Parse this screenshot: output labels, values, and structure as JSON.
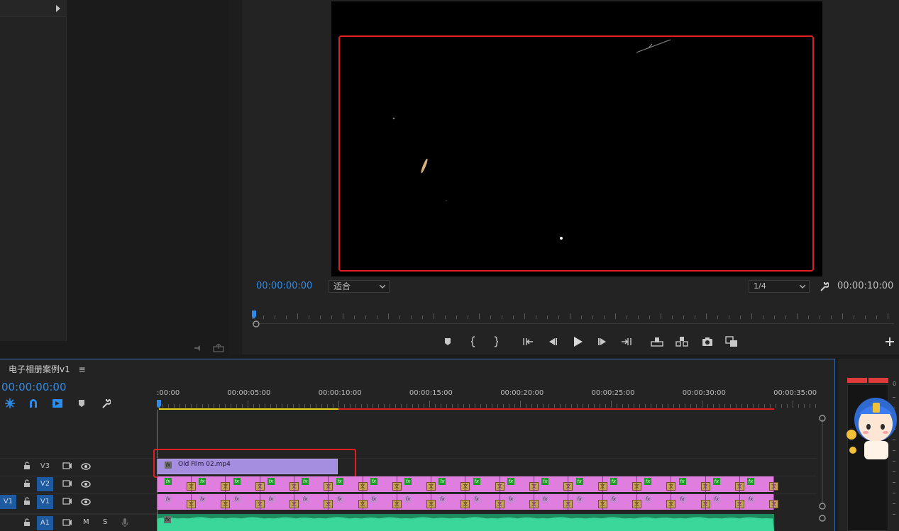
{
  "project_panel": {
    "expand_icon": "triangle-right-icon"
  },
  "program_monitor": {
    "current_timecode": "00:00:00:00",
    "fit_label": "适合",
    "resolution_label": "1/4",
    "duration_timecode": "00:00:10:00"
  },
  "transport": {
    "icons": [
      "marker-icon",
      "mark-in-icon",
      "mark-out-icon",
      "go-to-in-icon",
      "step-back-icon",
      "play-icon",
      "step-forward-icon",
      "go-to-out-icon",
      "lift-icon",
      "extract-icon",
      "camera-icon",
      "compare-icon",
      "add-button-icon"
    ]
  },
  "timeline": {
    "sequence_name": "电子相册案例v1",
    "menu_icon": "≡",
    "timecode": "00:00:00:00",
    "ruler_labels": [
      ":00:00",
      "00:00:05:00",
      "00:00:10:00",
      "00:00:15:00",
      "00:00:20:00",
      "00:00:25:00",
      "00:00:30:00",
      "00:00:35:00"
    ],
    "tracks": [
      {
        "name": "V3",
        "source": ""
      },
      {
        "name": "V2",
        "source": ""
      },
      {
        "name": "V1",
        "source": "V1"
      },
      {
        "name": "A1",
        "source": ""
      }
    ],
    "audio_buttons": {
      "mute": "M",
      "solo": "S"
    },
    "clip": {
      "name": "Old Film 02.mp4"
    },
    "colors": {
      "clip": "#a58ee0",
      "stills": "#e07ee0",
      "audio": "#27b97c",
      "highlight": "#e02020",
      "accent": "#2d8ceb"
    }
  },
  "audio_meter": {
    "top_label": "0"
  }
}
